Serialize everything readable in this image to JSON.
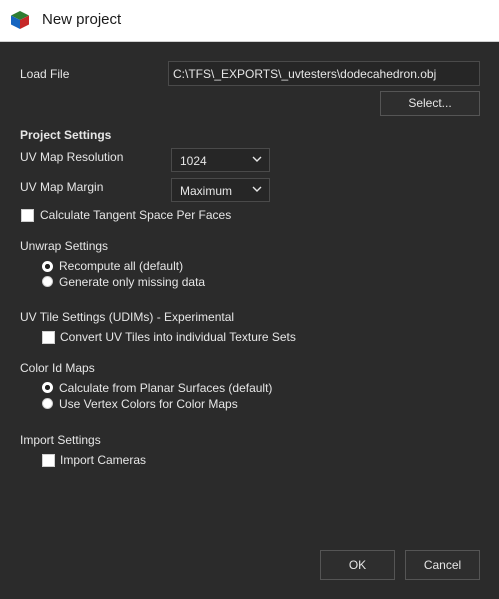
{
  "window": {
    "title": "New project",
    "icon": "app-cube-icon"
  },
  "load_file": {
    "label": "Load File",
    "path": "C:\\TFS\\_EXPORTS\\_uvtesters\\dodecahedron.obj",
    "select_button": "Select..."
  },
  "project_settings": {
    "heading": "Project Settings",
    "uv_map_resolution": {
      "label": "UV Map Resolution",
      "value": "1024"
    },
    "uv_map_margin": {
      "label": "UV Map Margin",
      "value": "Maximum"
    },
    "tangent_space": {
      "label": "Calculate Tangent Space Per Faces",
      "checked": false
    }
  },
  "unwrap_settings": {
    "heading": "Unwrap Settings",
    "options": [
      {
        "label": "Recompute all (default)",
        "selected": true
      },
      {
        "label": "Generate only missing data",
        "selected": false
      }
    ]
  },
  "uv_tile_settings": {
    "heading": "UV Tile Settings (UDIMs) - Experimental",
    "convert": {
      "label": "Convert UV Tiles into individual Texture Sets",
      "checked": false
    }
  },
  "color_id_maps": {
    "heading": "Color Id Maps",
    "options": [
      {
        "label": "Calculate from Planar Surfaces (default)",
        "selected": true
      },
      {
        "label": "Use Vertex Colors for Color Maps",
        "selected": false
      }
    ]
  },
  "import_settings": {
    "heading": "Import Settings",
    "import_cameras": {
      "label": "Import Cameras",
      "checked": false
    }
  },
  "footer": {
    "ok": "OK",
    "cancel": "Cancel"
  }
}
